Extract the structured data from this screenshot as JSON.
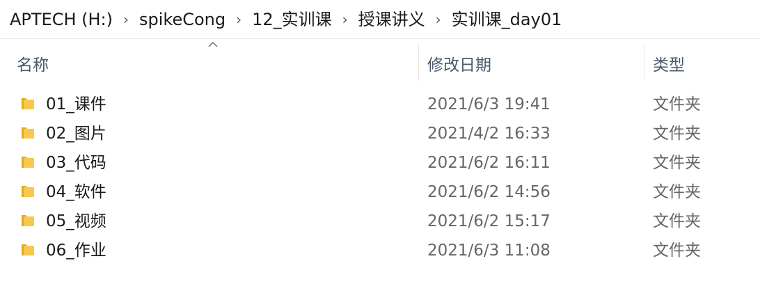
{
  "breadcrumb": [
    "APTECH (H:)",
    "spikeCong",
    "12_实训课",
    "授课讲义",
    "实训课_day01"
  ],
  "breadcrumb_separator": "›",
  "columns": {
    "name": "名称",
    "date": "修改日期",
    "type": "类型"
  },
  "sort": {
    "column": "name",
    "direction": "ascending"
  },
  "files": [
    {
      "name": "01_课件",
      "date": "2021/6/3 19:41",
      "type": "文件夹"
    },
    {
      "name": "02_图片",
      "date": "2021/4/2 16:33",
      "type": "文件夹"
    },
    {
      "name": "03_代码",
      "date": "2021/6/2 16:11",
      "type": "文件夹"
    },
    {
      "name": "04_软件",
      "date": "2021/6/2 14:56",
      "type": "文件夹"
    },
    {
      "name": "05_视频",
      "date": "2021/6/2 15:17",
      "type": "文件夹"
    },
    {
      "name": "06_作业",
      "date": "2021/6/3 11:08",
      "type": "文件夹"
    }
  ],
  "icons": {
    "folder": "folder-icon",
    "sort": "sort-ascending-icon",
    "separator": "chevron-right-icon"
  },
  "colors": {
    "folder": "#f6c94e",
    "header_text": "#4a5a6e",
    "secondary_text": "#666666"
  }
}
